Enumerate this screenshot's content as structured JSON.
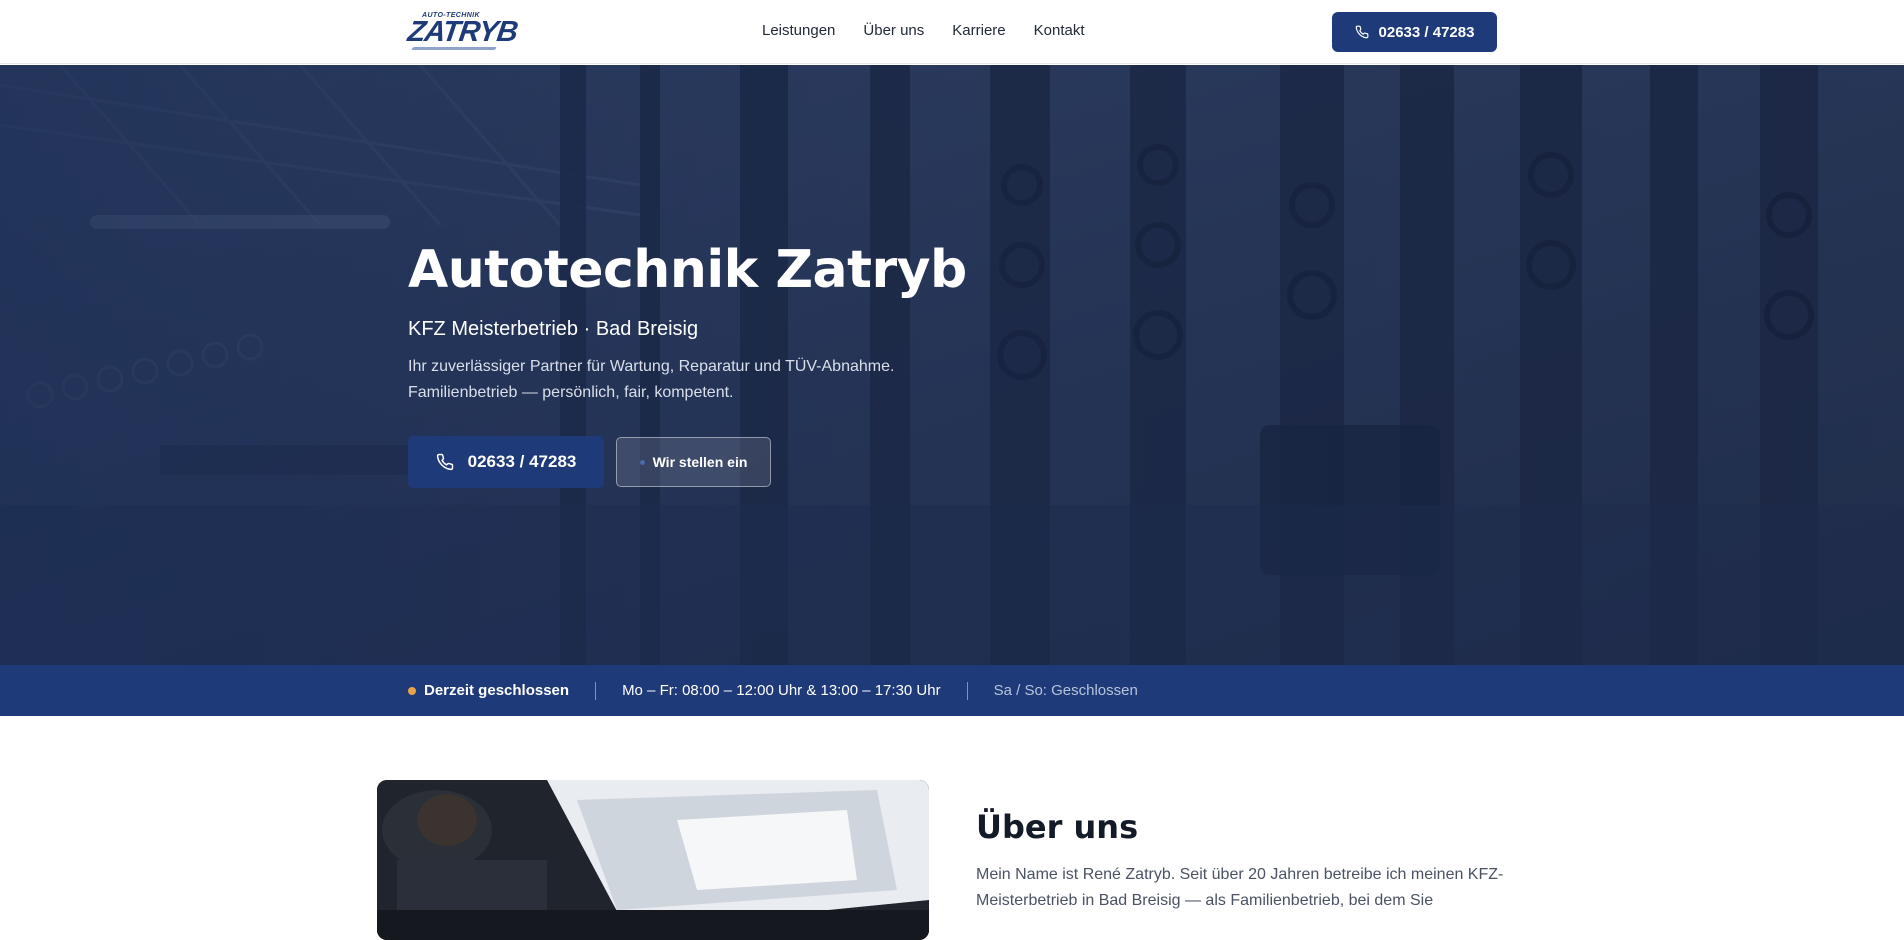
{
  "header": {
    "logo": {
      "small_text": "AUTO-TECHNIK",
      "main_text": "ZATRYB"
    },
    "nav": [
      {
        "label": "Leistungen"
      },
      {
        "label": "Über uns"
      },
      {
        "label": "Karriere"
      },
      {
        "label": "Kontakt"
      }
    ],
    "phone_button": {
      "label": "02633 / 47283",
      "icon": "phone-icon"
    }
  },
  "hero": {
    "title": "Autotechnik Zatryb",
    "subtitle": "KFZ Meisterbetrieb · Bad Breisig",
    "description_line1": "Ihr zuverlässiger Partner für Wartung, Reparatur und TÜV-Abnahme.",
    "description_line2": "Familienbetrieb — persönlich, fair, kompetent.",
    "primary_button": {
      "label": "02633 / 47283",
      "icon": "phone-icon"
    },
    "secondary_button": {
      "label": "Wir stellen ein"
    }
  },
  "hours": {
    "status": "Derzeit geschlossen",
    "weekdays": "Mo – Fr: 08:00 – 12:00 Uhr & 13:00 – 17:30 Uhr",
    "weekend": "Sa / So: Geschlossen",
    "status_color": "#e8a24a"
  },
  "about": {
    "title": "Über uns",
    "text": "Mein Name ist René Zatryb. Seit über 20 Jahren betreibe ich meinen KFZ-Meisterbetrieb in Bad Breisig — als Familienbetrieb, bei dem Sie"
  },
  "colors": {
    "brand": "#1e3a78",
    "hero_overlay": "#1b2d56",
    "text_dark": "#131a28"
  }
}
